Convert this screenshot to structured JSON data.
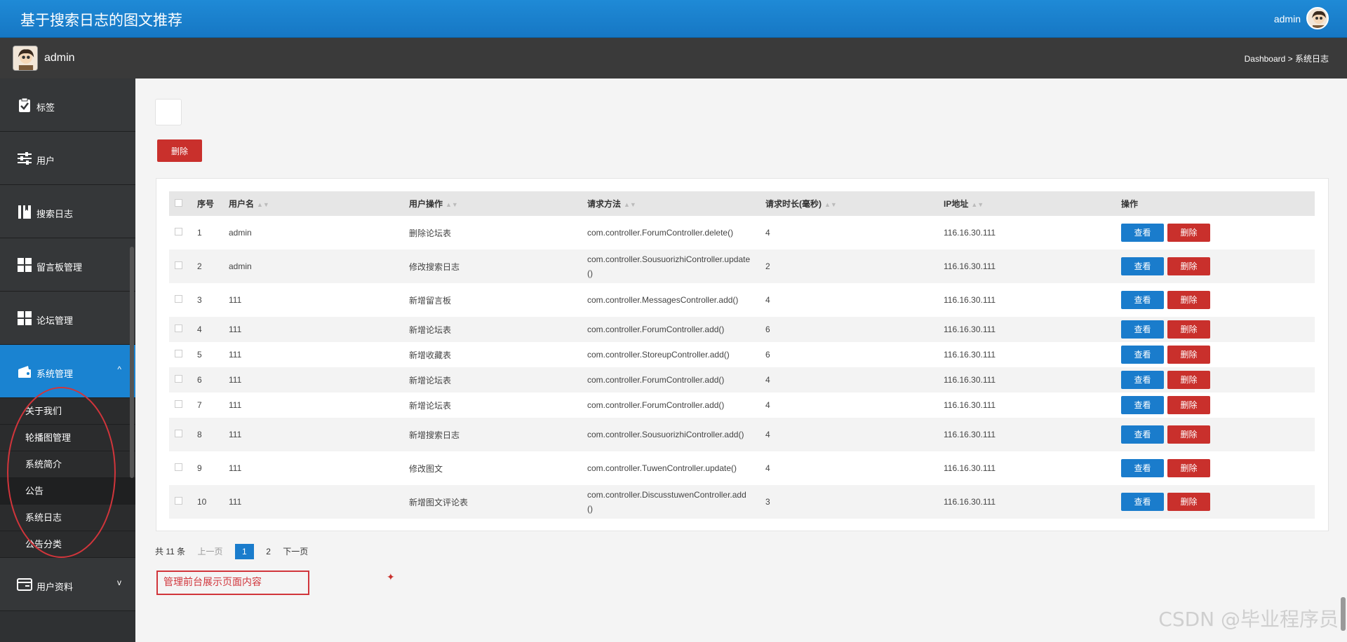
{
  "header": {
    "title": "基于搜索日志的图文推荐",
    "user": "admin"
  },
  "subbar": {
    "user": "admin",
    "breadcrumb": "Dashboard > 系统日志"
  },
  "sidebar": {
    "items": [
      {
        "label": "标签",
        "icon": "clipboard-check-icon"
      },
      {
        "label": "用户",
        "icon": "sliders-icon"
      },
      {
        "label": "搜索日志",
        "icon": "book-icon"
      },
      {
        "label": "留言板管理",
        "icon": "grid-icon"
      },
      {
        "label": "论坛管理",
        "icon": "grid-icon"
      },
      {
        "label": "系统管理",
        "icon": "wallet-icon",
        "chevron": "^"
      }
    ],
    "sub_items": [
      "关于我们",
      "轮播图管理",
      "系统简介",
      "公告",
      "系统日志",
      "公告分类"
    ],
    "footer_item": {
      "label": "用户资料",
      "icon": "card-icon",
      "chevron": "v"
    }
  },
  "toolbar": {
    "delete_label": "删除"
  },
  "table": {
    "headers": [
      "序号",
      "用户名",
      "用户操作",
      "请求方法",
      "请求时长(毫秒)",
      "IP地址",
      "操作"
    ],
    "view_label": "查看",
    "delete_label": "删除",
    "rows": [
      {
        "no": "1",
        "user": "admin",
        "op": "删除论坛表",
        "method": "com.controller.ForumController.delete()",
        "dur": "4",
        "ip": "116.16.30.111"
      },
      {
        "no": "2",
        "user": "admin",
        "op": "修改搜索日志",
        "method": "com.controller.SousuorizhiController.update()",
        "dur": "2",
        "ip": "116.16.30.111"
      },
      {
        "no": "3",
        "user": "111",
        "op": "新增留言板",
        "method": "com.controller.MessagesController.add()",
        "dur": "4",
        "ip": "116.16.30.111"
      },
      {
        "no": "4",
        "user": "111",
        "op": "新增论坛表",
        "method": "com.controller.ForumController.add()",
        "dur": "6",
        "ip": "116.16.30.111"
      },
      {
        "no": "5",
        "user": "111",
        "op": "新增收藏表",
        "method": "com.controller.StoreupController.add()",
        "dur": "6",
        "ip": "116.16.30.111"
      },
      {
        "no": "6",
        "user": "111",
        "op": "新增论坛表",
        "method": "com.controller.ForumController.add()",
        "dur": "4",
        "ip": "116.16.30.111"
      },
      {
        "no": "7",
        "user": "111",
        "op": "新增论坛表",
        "method": "com.controller.ForumController.add()",
        "dur": "4",
        "ip": "116.16.30.111"
      },
      {
        "no": "8",
        "user": "111",
        "op": "新增搜索日志",
        "method": "com.controller.SousuorizhiController.add()",
        "dur": "4",
        "ip": "116.16.30.111"
      },
      {
        "no": "9",
        "user": "111",
        "op": "修改图文",
        "method": "com.controller.TuwenController.update()",
        "dur": "4",
        "ip": "116.16.30.111"
      },
      {
        "no": "10",
        "user": "111",
        "op": "新增图文评论表",
        "method": "com.controller.DiscusstuwenController.add()",
        "dur": "3",
        "ip": "116.16.30.111"
      }
    ]
  },
  "pager": {
    "total": "共 11 条",
    "prev": "上一页",
    "current": "1",
    "page2": "2",
    "next": "下一页"
  },
  "annotation": "管理前台展示页面内容",
  "watermark": "CSDN @毕业程序员",
  "colors": {
    "primary": "#1a7ccc",
    "danger": "#c9302c",
    "sidebar": "#353739"
  }
}
